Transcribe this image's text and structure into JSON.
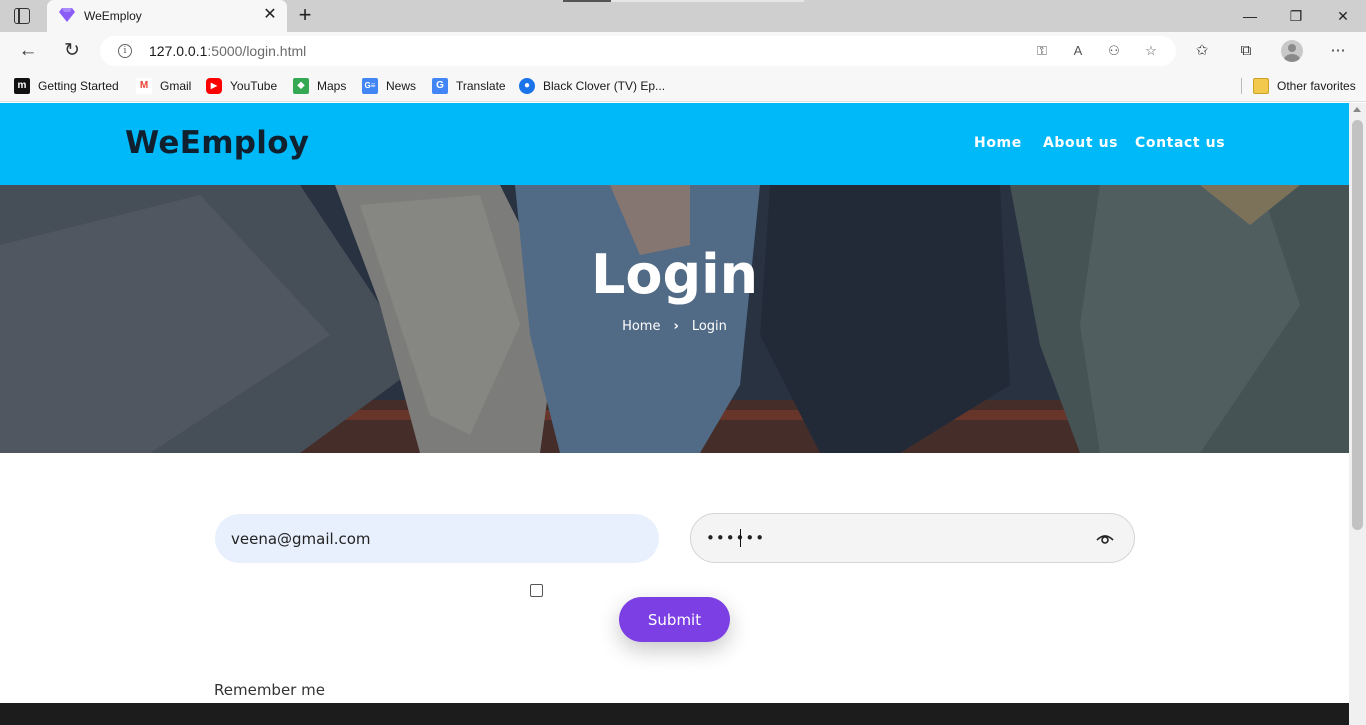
{
  "browser": {
    "tab_title": "WeEmploy",
    "tab_close": "✕",
    "new_tab": "+",
    "url_host": "127.0.0.1",
    "url_rest": ":5000/login.html",
    "bookmarks": [
      {
        "label": "Getting Started",
        "icon": "medium-icon",
        "color": "#111111"
      },
      {
        "label": "Gmail",
        "icon": "gmail-icon",
        "color": "#ea4335"
      },
      {
        "label": "YouTube",
        "icon": "youtube-icon",
        "color": "#ff0000"
      },
      {
        "label": "Maps",
        "icon": "maps-icon",
        "color": "#34a853"
      },
      {
        "label": "News",
        "icon": "news-icon",
        "color": "#4285f4"
      },
      {
        "label": "Translate",
        "icon": "translate-icon",
        "color": "#4285f4"
      },
      {
        "label": "Black Clover (TV) Ep...",
        "icon": "globe-icon",
        "color": "#1a73e8"
      }
    ],
    "other_favorites": "Other favorites"
  },
  "site": {
    "logo": "WeEmploy",
    "nav": [
      "Home",
      "About us",
      "Contact us"
    ],
    "header_color": "#00b9f8"
  },
  "hero": {
    "title": "Login",
    "breadcrumb_home": "Home",
    "breadcrumb_sep": "›",
    "breadcrumb_current": "Login"
  },
  "form": {
    "email_value": "veena@gmail.com",
    "password_masked": "••••••",
    "remember_label": "Remember me",
    "submit_label": "Submit",
    "accent_color": "#7b3fe4"
  }
}
